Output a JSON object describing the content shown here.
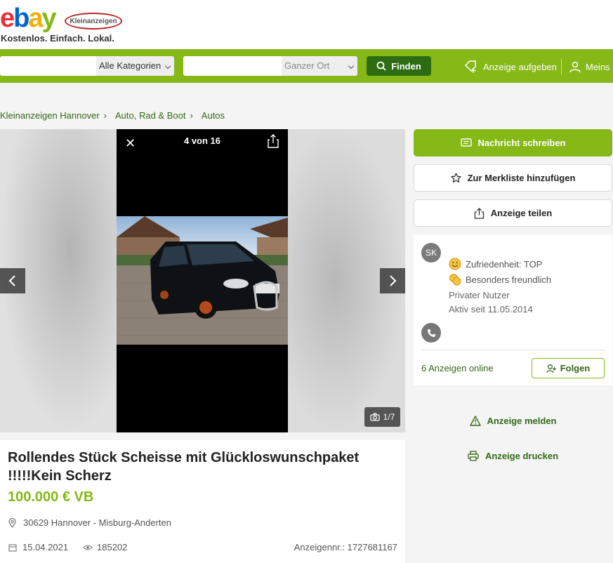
{
  "header": {
    "logo_text": "ebay",
    "logo_badge": "Kleinanzeigen",
    "tagline": "Kostenlos. Einfach. Lokal."
  },
  "searchbar": {
    "query_value": "",
    "category_selected": "Alle Kategorien",
    "location_value": "",
    "radius_selected": "Ganzer Ort",
    "find_label": "Finden",
    "post_ad_label": "Anzeige aufgeben",
    "account_label": "Meins"
  },
  "breadcrumb": [
    "Kleinanzeigen Hannover",
    "Auto, Rad & Boot",
    "Autos"
  ],
  "gallery": {
    "phone_counter": "4 von 16",
    "image_counter": "1/7"
  },
  "listing": {
    "title": "Rollendes Stück Scheisse mit Glückloswunschpaket !!!!!Kein Scherz",
    "price": "100.000 € VB",
    "location": "30629 Hannover - Misburg-Anderten",
    "date": "15.04.2021",
    "views": "185202",
    "ad_number": "Anzeigennr.: 1727681167"
  },
  "sidebar": {
    "message_label": "Nachricht schreiben",
    "watchlist_label": "Zur Merkliste hinzufügen",
    "share_label": "Anzeige teilen",
    "seller": {
      "initials": "SK",
      "satisfaction": "Zufriedenheit: TOP",
      "friendly": "Besonders freundlich",
      "type": "Privater Nutzer",
      "active_since": "Aktiv seit 11.05.2014",
      "ads_online": "6 Anzeigen online",
      "follow_label": "Folgen"
    },
    "report_label": "Anzeige melden",
    "print_label": "Anzeige drucken"
  },
  "colors": {
    "brand_green": "#86b817",
    "dark_green": "#326916",
    "find_button": "#2e6c13"
  }
}
